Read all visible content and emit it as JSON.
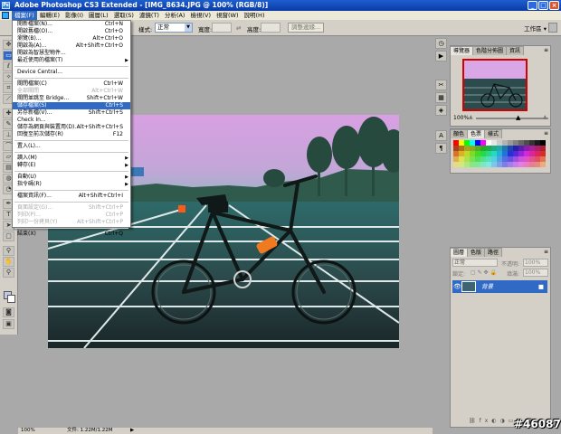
{
  "window": {
    "title": "Adobe Photoshop CS3 Extended - [IMG_8634.JPG @ 100% (RGB/8)]",
    "app_icon": "Ps",
    "controls": [
      "minimize-icon",
      "maximize-icon",
      "close-icon"
    ]
  },
  "menubar": [
    "檔案(F)",
    "編輯(E)",
    "影像(I)",
    "圖層(L)",
    "選取(S)",
    "濾鏡(T)",
    "分析(A)",
    "檢視(V)",
    "視窗(W)",
    "說明(H)"
  ],
  "options": {
    "style_label": "樣式:",
    "style_value": "正常",
    "width_label": "寬度:",
    "height_label": "高度:",
    "refine_edge": "調整邊緣...",
    "workspace": "工作區 ▾"
  },
  "file_menu": {
    "items": [
      {
        "label": "開新檔案(N)...",
        "shortcut": "Ctrl+N",
        "state": "normal"
      },
      {
        "label": "開啟舊檔(O)...",
        "shortcut": "Ctrl+O",
        "state": "normal"
      },
      {
        "label": "瀏覽(B)...",
        "shortcut": "Alt+Ctrl+O",
        "state": "normal"
      },
      {
        "label": "開啟為(A)...",
        "shortcut": "Alt+Shift+Ctrl+O",
        "state": "normal"
      },
      {
        "label": "開啟為智慧型物件...",
        "shortcut": "",
        "state": "normal"
      },
      {
        "label": "最近使用的檔案(T)",
        "shortcut": "",
        "state": "submenu"
      },
      {
        "sep": true
      },
      {
        "label": "Device Central...",
        "shortcut": "",
        "state": "normal"
      },
      {
        "sep": true
      },
      {
        "label": "關閉檔案(C)",
        "shortcut": "Ctrl+W",
        "state": "normal"
      },
      {
        "label": "全部關閉",
        "shortcut": "Alt+Ctrl+W",
        "state": "disabled"
      },
      {
        "label": "關閉並跳至 Bridge...",
        "shortcut": "Shift+Ctrl+W",
        "state": "normal"
      },
      {
        "label": "儲存檔案(S)",
        "shortcut": "Ctrl+S",
        "state": "highlighted"
      },
      {
        "label": "另存新檔(V)...",
        "shortcut": "Shift+Ctrl+S",
        "state": "normal"
      },
      {
        "label": "Check In...",
        "shortcut": "",
        "state": "normal"
      },
      {
        "label": "儲存為網頁與裝置用(D)...",
        "shortcut": "Alt+Shift+Ctrl+S",
        "state": "normal"
      },
      {
        "label": "回復至前次儲存(R)",
        "shortcut": "F12",
        "state": "normal"
      },
      {
        "sep": true
      },
      {
        "label": "置入(L)...",
        "shortcut": "",
        "state": "normal"
      },
      {
        "sep": true
      },
      {
        "label": "讀入(M)",
        "shortcut": "",
        "state": "submenu"
      },
      {
        "label": "轉存(E)",
        "shortcut": "",
        "state": "submenu"
      },
      {
        "sep": true
      },
      {
        "label": "自動(U)",
        "shortcut": "",
        "state": "submenu"
      },
      {
        "label": "指令碼(R)",
        "shortcut": "",
        "state": "submenu"
      },
      {
        "sep": true
      },
      {
        "label": "檔案資訊(F)...",
        "shortcut": "Alt+Shift+Ctrl+I",
        "state": "normal"
      },
      {
        "sep": true
      },
      {
        "label": "頁面設定(G)...",
        "shortcut": "Shift+Ctrl+P",
        "state": "disabled"
      },
      {
        "label": "列印(P)...",
        "shortcut": "Ctrl+P",
        "state": "disabled"
      },
      {
        "label": "列印一份拷貝(Y)",
        "shortcut": "Alt+Shift+Ctrl+P",
        "state": "disabled"
      },
      {
        "sep": true
      },
      {
        "label": "結束(X)",
        "shortcut": "Ctrl+Q",
        "state": "normal"
      }
    ]
  },
  "navigator": {
    "tabs": [
      "導覽器",
      "色階分佈圖",
      "資訊"
    ],
    "zoom": "100%"
  },
  "color": {
    "tabs": [
      "顏色",
      "色票",
      "樣式"
    ]
  },
  "layers": {
    "tabs": [
      "圖層",
      "色版",
      "路徑"
    ],
    "blend_mode": "正常",
    "opacity_label": "不透明:",
    "opacity_value": "100%",
    "lock_label": "鎖定:",
    "fill_label": "填滿:",
    "fill_value": "100%",
    "layer_name": "背景"
  },
  "status": {
    "zoom": "100%",
    "doc_info": "文件: 1.22M/1.22M"
  },
  "watermark": "#46087",
  "colors": {
    "titlebar": "#0b3aa5",
    "menu_highlight": "#316ac5",
    "sky": "#d9a6e6",
    "court": "#2f4a4c"
  }
}
